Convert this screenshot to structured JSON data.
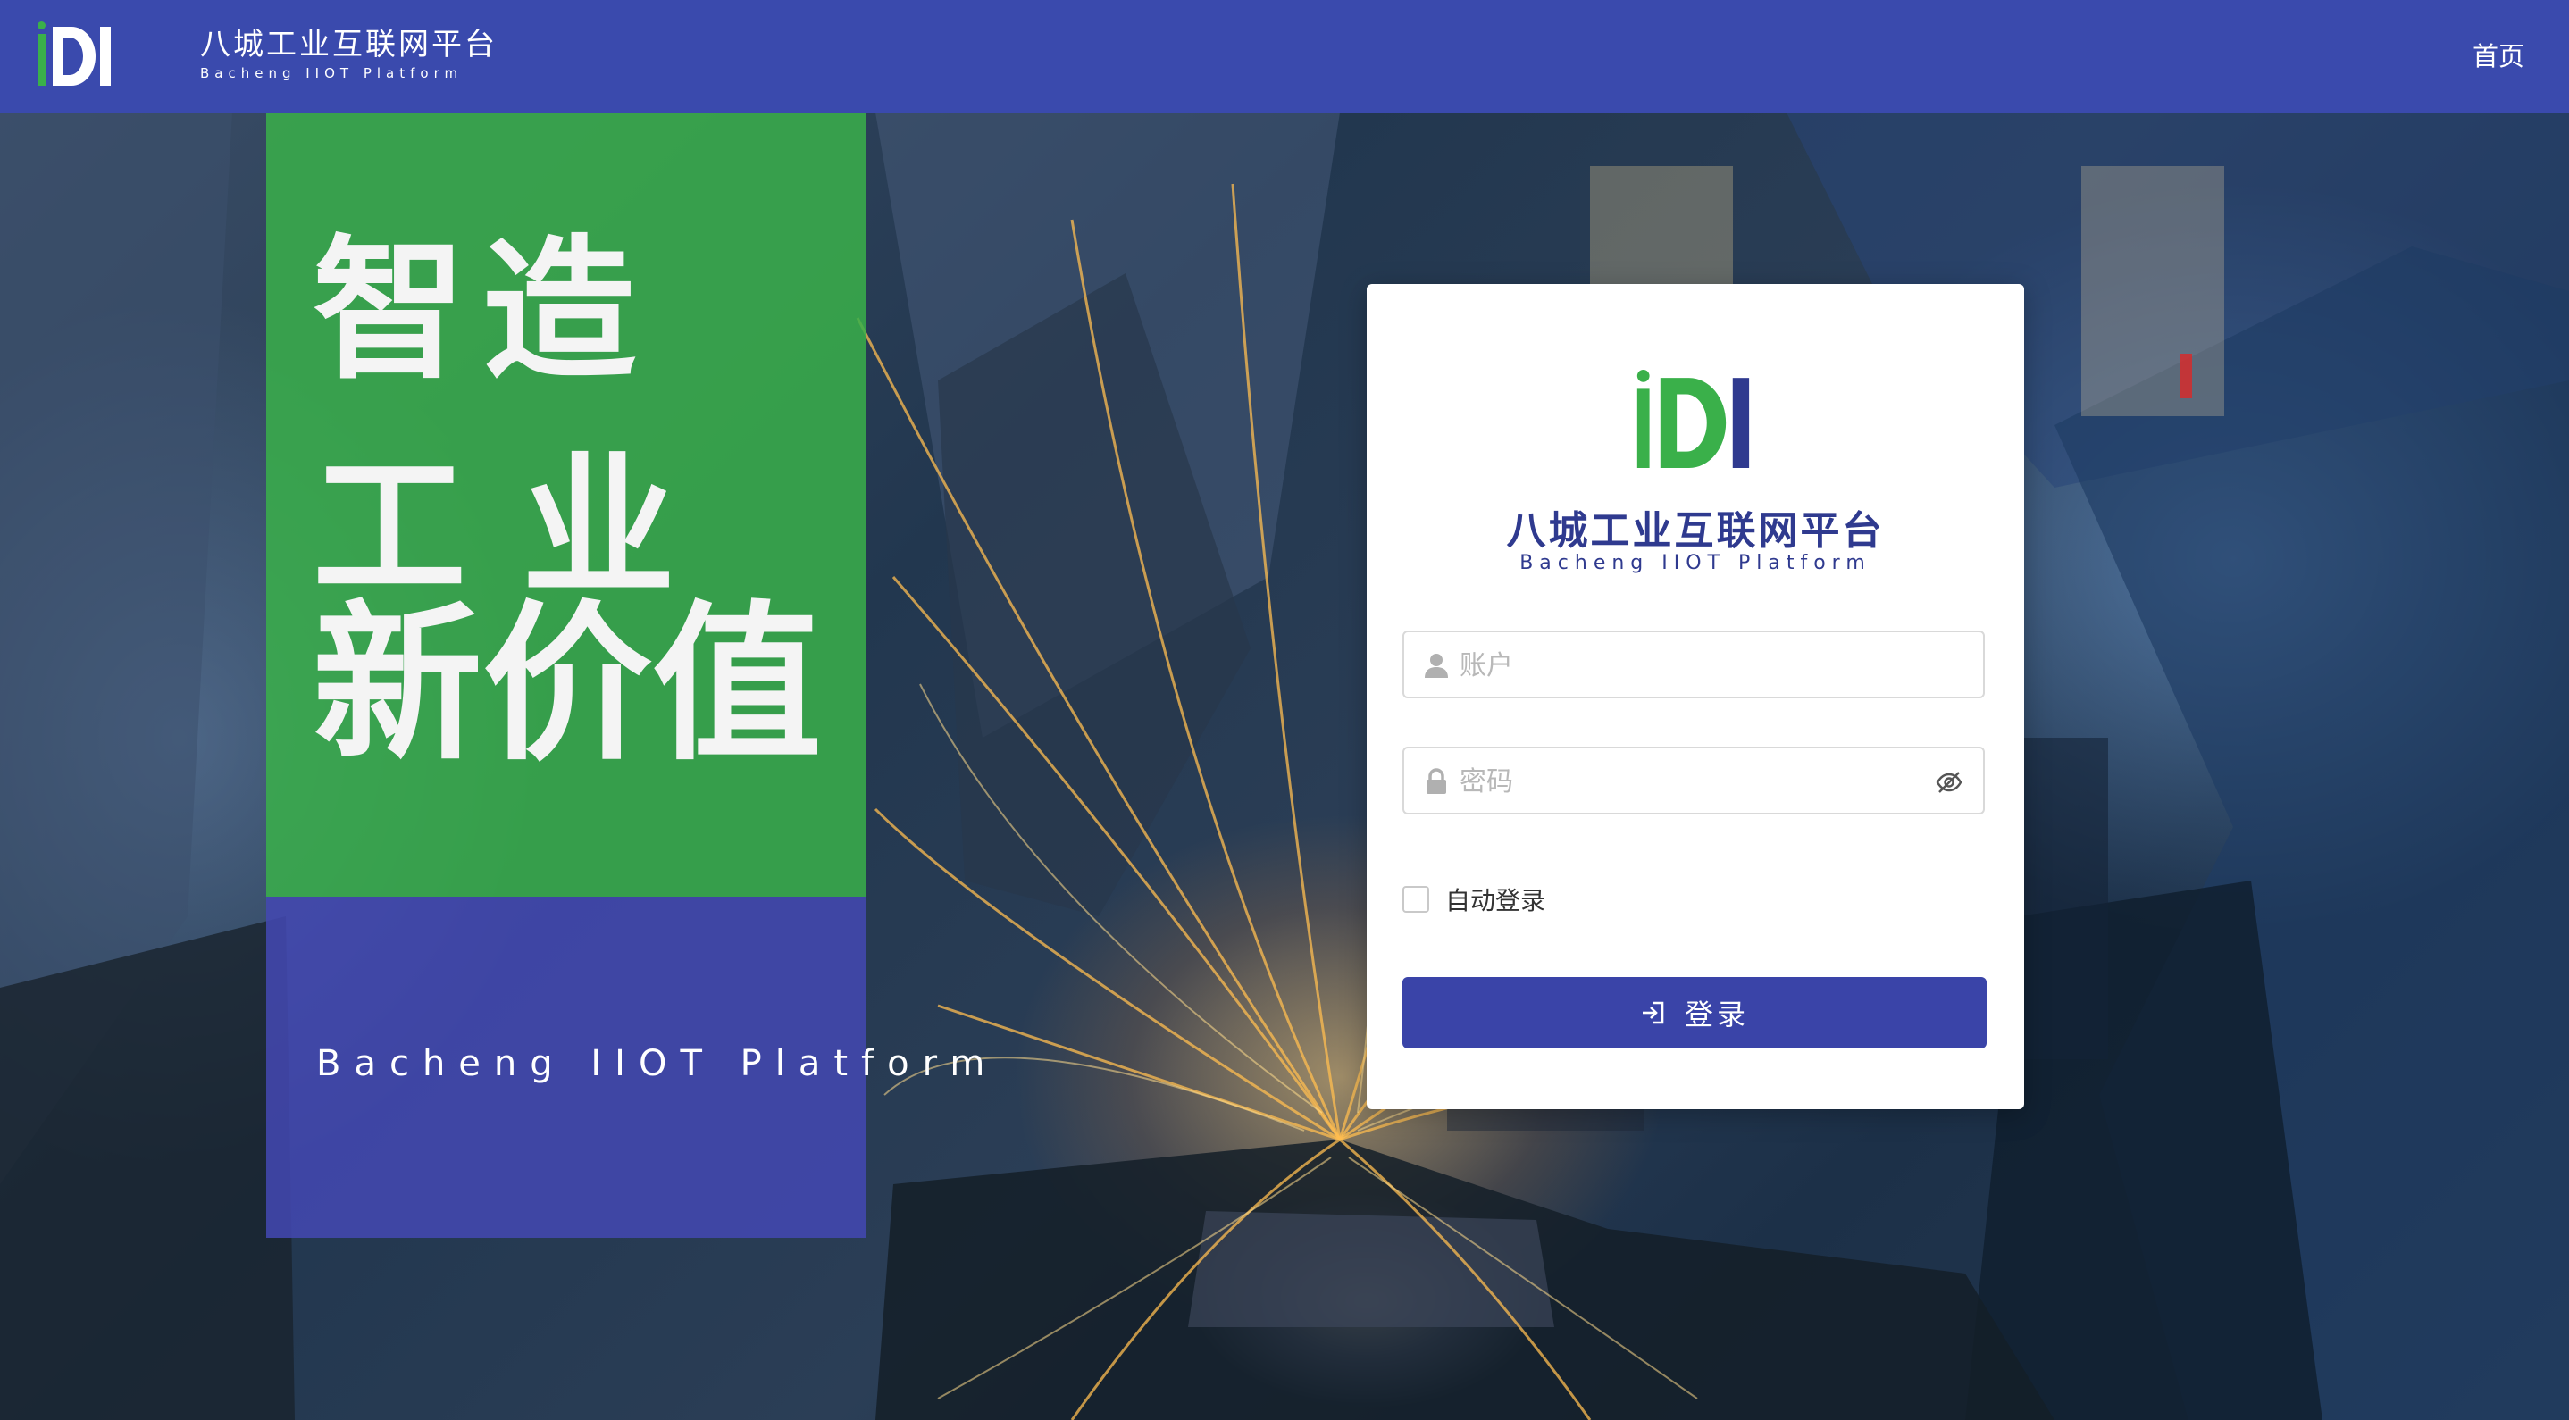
{
  "header": {
    "brand_cn": "八城工业互联网平台",
    "brand_en": "Bacheng IIOT Platform",
    "nav_home": "首页"
  },
  "hero": {
    "line1": "智造",
    "line2": "工业",
    "line3": "新价值",
    "subtitle": "Bacheng IIOT Platform"
  },
  "login": {
    "brand_cn": "八城工业互联网平台",
    "brand_en": "Bacheng IIOT Platform",
    "account_placeholder": "账户",
    "password_placeholder": "密码",
    "remember_label": "自动登录",
    "remember_checked": false,
    "submit_label": "登录"
  },
  "colors": {
    "header_bg": "#3a4aad",
    "green_panel": "#3ab04a",
    "blue_panel": "#4448b2",
    "brand_text": "#2f3a8f",
    "button_bg": "#3a44a8",
    "logo_green": "#3ab04a",
    "logo_blue": "#2f3a8f"
  },
  "icons": {
    "account": "user-icon",
    "password": "lock-icon",
    "toggle_password": "eye-slash-icon",
    "submit": "login-icon"
  }
}
